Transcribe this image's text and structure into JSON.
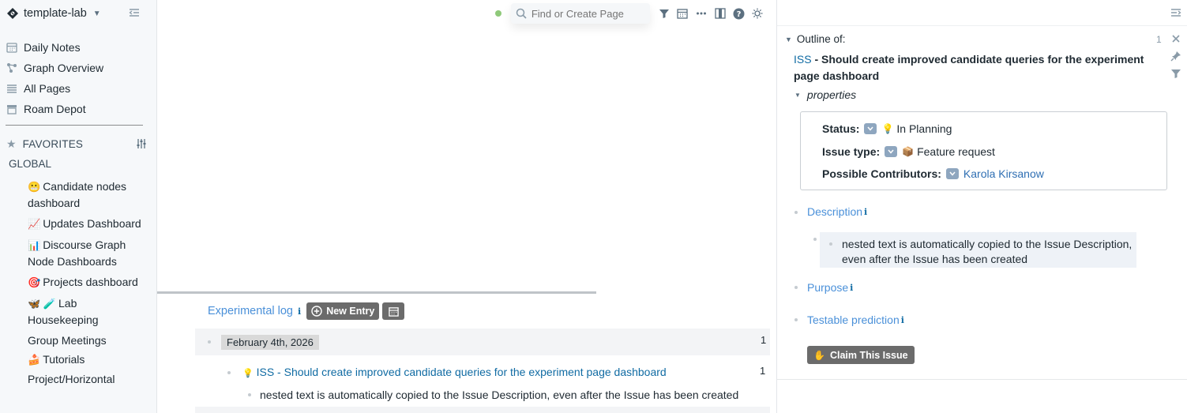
{
  "sidebar": {
    "graph_name": "template-lab",
    "nav": [
      {
        "label": "Daily Notes",
        "icon": "calendar-icon"
      },
      {
        "label": "Graph Overview",
        "icon": "graph-icon"
      },
      {
        "label": "All Pages",
        "icon": "list-icon"
      },
      {
        "label": "Roam Depot",
        "icon": "shop-icon"
      }
    ],
    "favorites_label": "FAVORITES",
    "global_label": "GLOBAL",
    "favorites": [
      {
        "emoji": "😬",
        "label": "Candidate nodes dashboard"
      },
      {
        "emoji": "📈",
        "label": "Updates Dashboard"
      },
      {
        "emoji": "📊",
        "label": "Discourse Graph Node Dashboards"
      },
      {
        "emoji": "🎯",
        "label": "Projects dashboard"
      },
      {
        "emoji": "🦋 🧪",
        "label": "Lab Housekeeping"
      },
      {
        "emoji": "",
        "label": "Group Meetings"
      },
      {
        "emoji": "🍰",
        "label": "Tutorials"
      },
      {
        "emoji": "",
        "label": "Project/Horizontal"
      }
    ]
  },
  "topbar": {
    "search_placeholder": "Find or Create Page",
    "status_color": "#8fc97a"
  },
  "main": {
    "log_title": "Experimental log",
    "info_glyph": "i",
    "new_entry_label": "New Entry",
    "date": "February 4th, 2026",
    "date_count": "1",
    "issue_prefix": "ISS",
    "issue_title": " - Should create improved candidate queries for the experiment page dashboard",
    "issue_emoji": "💡",
    "issue_count": "1",
    "nested_text": "nested text is automatically copied to the Issue Description, even after the Issue has been created"
  },
  "right_panel": {
    "outline_label": "Outline of:",
    "count": "1",
    "title_prefix": "ISS",
    "title_rest": " - Should create improved candidate queries for the experiment page dashboard",
    "properties_label": "properties",
    "status_label": "Status:",
    "status_emoji": "💡",
    "status_value": "In Planning",
    "issue_type_label": "Issue type:",
    "issue_type_emoji": "📦",
    "issue_type_value": "Feature request",
    "contributors_label": "Possible Contributors:",
    "contributor": "Karola Kirsanow",
    "description_label": "Description",
    "description_text": "nested text is automatically copied to the Issue Description, even after the Issue has been created",
    "purpose_label": "Purpose",
    "testable_label": "Testable prediction",
    "claim_label": "Claim This Issue"
  }
}
